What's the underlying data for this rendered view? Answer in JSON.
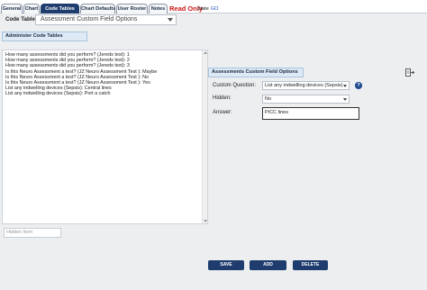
{
  "tabs": [
    {
      "label": "General"
    },
    {
      "label": "Chart"
    },
    {
      "label": "Code Tables"
    },
    {
      "label": "Chart Defaults"
    },
    {
      "label": "User Roster"
    },
    {
      "label": "Notes"
    }
  ],
  "active_tab": "Code Tables",
  "read_only": "Read Only",
  "state": {
    "label": "State",
    "value": "GO"
  },
  "code_table": {
    "label": "Code Table:",
    "value": "Assessment Custom Field Options"
  },
  "admin_header": "Administer Code Tables",
  "list_items": [
    "How many assessments did you perform? (Jereds test): 1",
    "How many assessments did you perform? (Jereds test): 2",
    "How many assessments did you perform? (Jereds test): 3",
    "Is this Neuro Assessment a test? (JZ Neuro Assessment Test ): Maybe",
    "Is this Neuro Assessment a test? (JZ Neuro Assessment Test ): No",
    "Is this Neuro Assessment a test? (JZ Neuro Assessment Test ): Yes",
    "List any indwelling devices (Sepsis): Central lines",
    "List any indwelling devices (Sepsis): Port a catch"
  ],
  "hidden_item_placeholder": "Hidden Item",
  "acf_header": "Assessments Custom Field Options",
  "form": {
    "custom_question_label": "Custom Question:",
    "custom_question_value": "List any indwelling devices (Sepsis)",
    "hidden_label": "Hidden:",
    "hidden_value": "No",
    "answer_label": "Answer:",
    "answer_value": "PICC lines"
  },
  "buttons": {
    "save": "SAVE",
    "add": "ADD",
    "delete": "DELETE"
  },
  "icons": {
    "help": "help-icon",
    "export": "export-icon"
  },
  "colors": {
    "accent": "#1e3d6e",
    "read_only": "#cc1414",
    "header_bg": "#dde9f4"
  }
}
